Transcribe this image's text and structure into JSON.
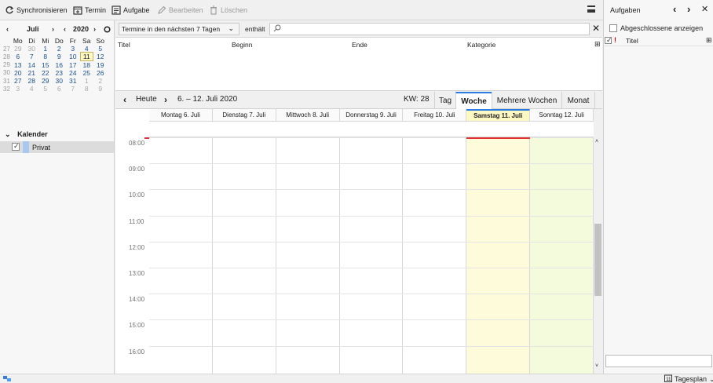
{
  "toolbar": {
    "sync": "Synchronisieren",
    "event": "Termin",
    "task": "Aufgabe",
    "edit": "Bearbeiten",
    "delete": "Löschen"
  },
  "minimonth": {
    "month": "Juli",
    "year": "2020",
    "weekdays": [
      "Mo",
      "Di",
      "Mi",
      "Do",
      "Fr",
      "Sa",
      "So"
    ],
    "weeks": [
      {
        "wk": "27",
        "days": [
          [
            "29",
            "other"
          ],
          [
            "30",
            "other"
          ],
          [
            "1",
            "normal"
          ],
          [
            "2",
            "normal"
          ],
          [
            "3",
            "normal"
          ],
          [
            "4",
            "normal"
          ],
          [
            "5",
            "normal"
          ]
        ]
      },
      {
        "wk": "28",
        "days": [
          [
            "6",
            "normal"
          ],
          [
            "7",
            "normal"
          ],
          [
            "8",
            "normal"
          ],
          [
            "9",
            "normal"
          ],
          [
            "10",
            "normal"
          ],
          [
            "11",
            "today"
          ],
          [
            "12",
            "normal"
          ]
        ]
      },
      {
        "wk": "29",
        "days": [
          [
            "13",
            "normal"
          ],
          [
            "14",
            "normal"
          ],
          [
            "15",
            "normal"
          ],
          [
            "16",
            "normal"
          ],
          [
            "17",
            "normal"
          ],
          [
            "18",
            "normal"
          ],
          [
            "19",
            "normal"
          ]
        ]
      },
      {
        "wk": "30",
        "days": [
          [
            "20",
            "normal"
          ],
          [
            "21",
            "normal"
          ],
          [
            "22",
            "normal"
          ],
          [
            "23",
            "normal"
          ],
          [
            "24",
            "normal"
          ],
          [
            "25",
            "normal"
          ],
          [
            "26",
            "normal"
          ]
        ]
      },
      {
        "wk": "31",
        "days": [
          [
            "27",
            "normal"
          ],
          [
            "28",
            "normal"
          ],
          [
            "29",
            "normal"
          ],
          [
            "30",
            "normal"
          ],
          [
            "31",
            "normal"
          ],
          [
            "1",
            "other"
          ],
          [
            "2",
            "other"
          ]
        ]
      },
      {
        "wk": "32",
        "days": [
          [
            "3",
            "other"
          ],
          [
            "4",
            "other"
          ],
          [
            "5",
            "other"
          ],
          [
            "6",
            "other"
          ],
          [
            "7",
            "other"
          ],
          [
            "8",
            "other"
          ],
          [
            "9",
            "other"
          ]
        ]
      }
    ]
  },
  "calendars": {
    "section": "Kalender",
    "items": [
      {
        "name": "Privat",
        "checked": true,
        "color": "#a8c8f0"
      }
    ]
  },
  "filter": {
    "range": "Termine in den nächsten 7 Tagen",
    "contains": "enthält",
    "search_value": ""
  },
  "eventlist": {
    "columns": [
      "Titel",
      "Beginn",
      "Ende",
      "Kategorie"
    ]
  },
  "weeknav": {
    "today": "Heute",
    "range": "6. – 12. Juli 2020",
    "kw": "KW: 28",
    "views": [
      "Tag",
      "Woche",
      "Mehrere Wochen",
      "Monat"
    ],
    "active_view": "Woche"
  },
  "week": {
    "days": [
      {
        "label": "Montag 6. Juli",
        "kind": "normal"
      },
      {
        "label": "Dienstag 7. Juli",
        "kind": "normal"
      },
      {
        "label": "Mittwoch 8. Juli",
        "kind": "normal"
      },
      {
        "label": "Donnerstag 9. Juli",
        "kind": "normal"
      },
      {
        "label": "Freitag 10. Juli",
        "kind": "normal"
      },
      {
        "label": "Samstag 11. Juli",
        "kind": "today"
      },
      {
        "label": "Sonntag 12. Juli",
        "kind": "weekend"
      }
    ],
    "hours": [
      "08:00",
      "09:00",
      "10:00",
      "11:00",
      "12:00",
      "13:00",
      "14:00",
      "15:00",
      "16:00"
    ]
  },
  "tasks": {
    "title": "Aufgaben",
    "show_completed": "Abgeschlossene anzeigen",
    "column_title": "Titel",
    "new_task_value": ""
  },
  "statusbar": {
    "view_mode": "Tagesplan"
  },
  "colors": {
    "accent": "#2a7de1",
    "today_bg": "#fef9c3",
    "now_line": "#e03030"
  }
}
